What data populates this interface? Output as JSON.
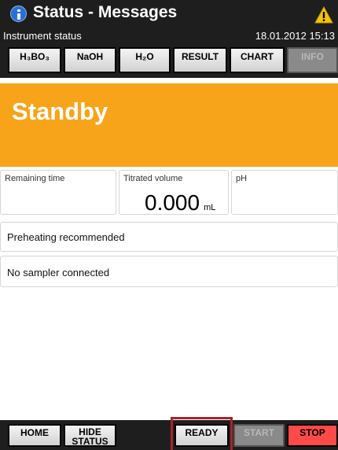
{
  "header": {
    "title": "Status - Messages",
    "subtitle": "Instrument status",
    "datetime": "18.01.2012 15:13"
  },
  "tabs": [
    {
      "label": "H₃BO₃",
      "enabled": true
    },
    {
      "label": "NaOH",
      "enabled": true
    },
    {
      "label": "H₂O",
      "enabled": true
    },
    {
      "label": "RESULT",
      "enabled": true
    },
    {
      "label": "CHART",
      "enabled": true
    },
    {
      "label": "INFO",
      "enabled": false
    }
  ],
  "status": {
    "state": "Standby",
    "color": "#f7a41a"
  },
  "measurements": {
    "remaining_time_label": "Remaining time",
    "remaining_time_value": "",
    "titrated_volume_label": "Titrated volume",
    "titrated_volume_value": "0.000",
    "titrated_volume_unit": "mL",
    "ph_label": "pH",
    "ph_value": ""
  },
  "messages": [
    "Preheating recommended",
    "No sampler connected"
  ],
  "bottom": {
    "home": "HOME",
    "hide_status_line1": "HIDE",
    "hide_status_line2": "STATUS",
    "ready": "READY",
    "start": "START",
    "stop": "STOP"
  },
  "colors": {
    "header_bg": "#1e1e1e",
    "stop_button": "#ff4a4a",
    "ready_highlight": "#a8242b",
    "info_icon": "#2a6fd6",
    "warning_icon": "#f5c400"
  },
  "icons": {
    "title_icon": "info-icon",
    "alert_icon": "warning-icon"
  }
}
